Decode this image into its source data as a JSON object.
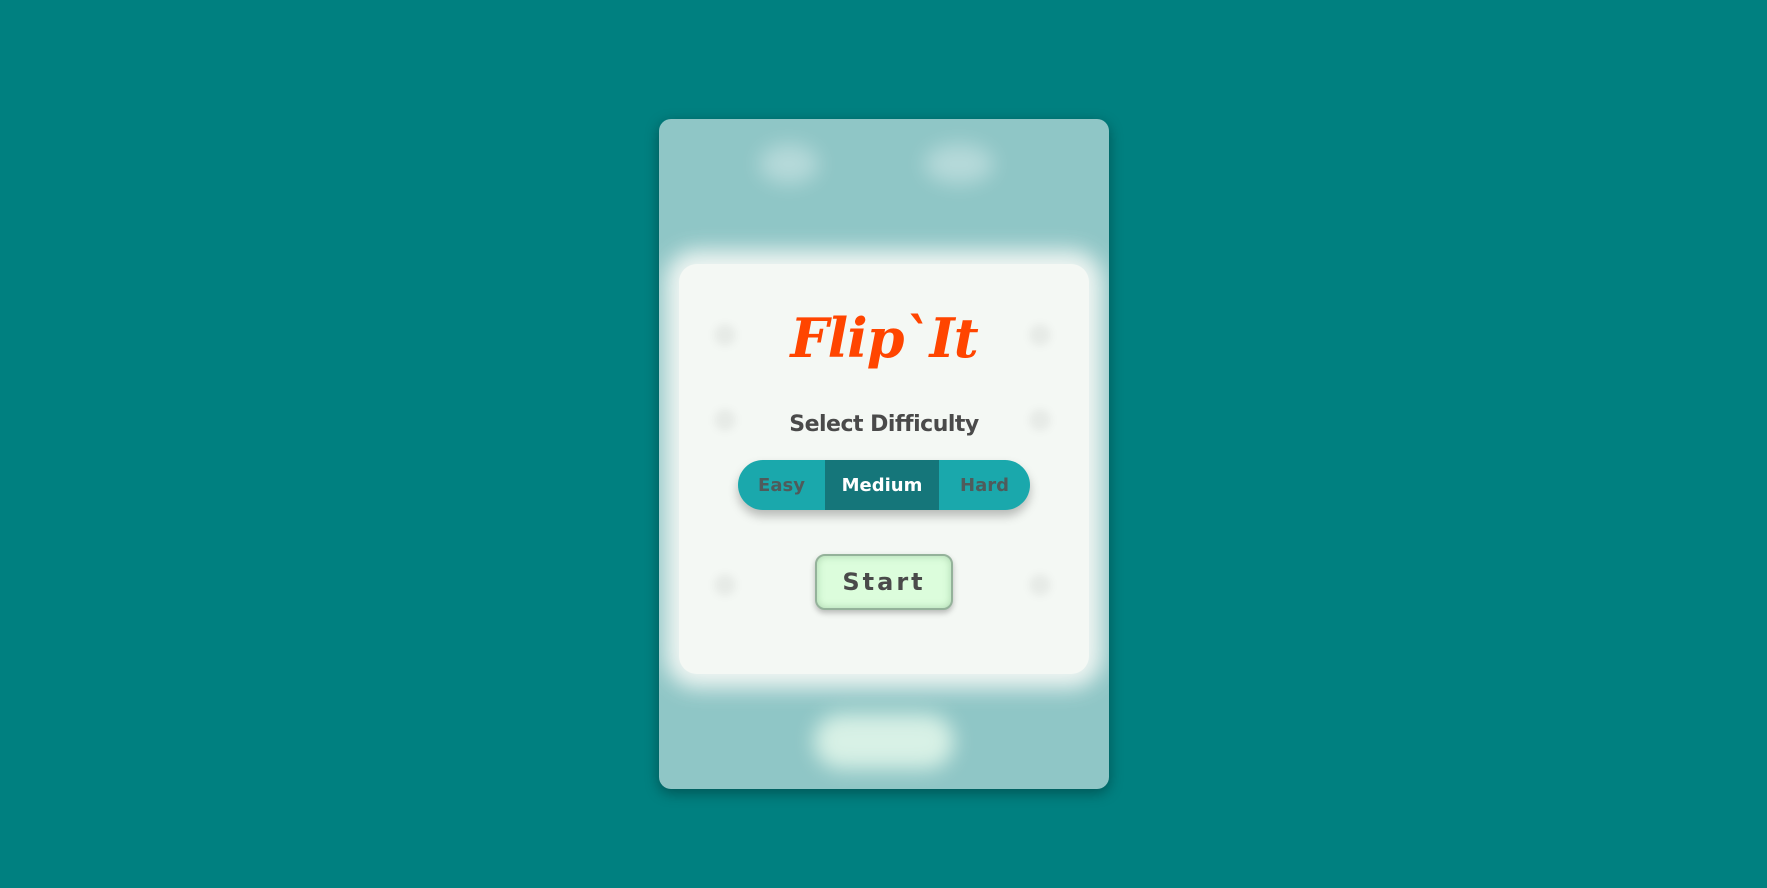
{
  "app": {
    "title": "Flip`It"
  },
  "menu": {
    "subtitle": "Select Difficulty",
    "difficulty_options": [
      "Easy",
      "Medium",
      "Hard"
    ],
    "selected_difficulty": "Medium",
    "start_label": "Start"
  },
  "colors": {
    "background": "#008080",
    "title": "#ff4500",
    "toggle": "#1aa8ac",
    "toggle_selected": "#15767a",
    "start_button": "#dcfddc"
  }
}
